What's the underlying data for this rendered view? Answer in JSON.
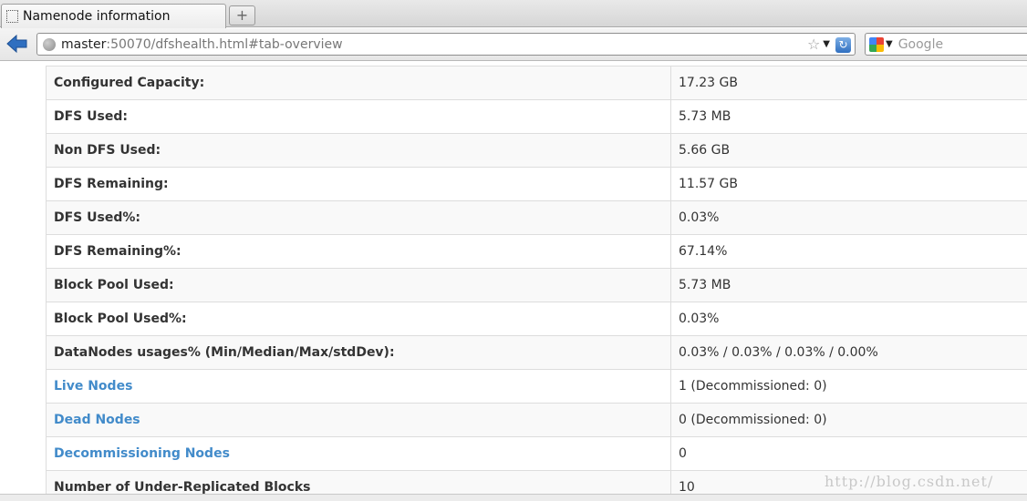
{
  "browser": {
    "tab_title": "Namenode information",
    "new_tab_symbol": "+",
    "url_host": "master",
    "url_rest": ":50070/dfshealth.html#tab-overview",
    "search_placeholder": "Google"
  },
  "overview": {
    "rows": [
      {
        "label": "Configured Capacity:",
        "value": "17.23 GB",
        "link": false
      },
      {
        "label": "DFS Used:",
        "value": "5.73 MB",
        "link": false
      },
      {
        "label": "Non DFS Used:",
        "value": "5.66 GB",
        "link": false
      },
      {
        "label": "DFS Remaining:",
        "value": "11.57 GB",
        "link": false
      },
      {
        "label": "DFS Used%:",
        "value": "0.03%",
        "link": false
      },
      {
        "label": "DFS Remaining%:",
        "value": "67.14%",
        "link": false
      },
      {
        "label": "Block Pool Used:",
        "value": "5.73 MB",
        "link": false
      },
      {
        "label": "Block Pool Used%:",
        "value": "0.03%",
        "link": false
      },
      {
        "label": "DataNodes usages% (Min/Median/Max/stdDev):",
        "value": "0.03% / 0.03% / 0.03% / 0.00%",
        "link": false
      },
      {
        "label": "Live Nodes",
        "value": "1 (Decommissioned: 0)",
        "link": true
      },
      {
        "label": "Dead Nodes",
        "value": "0 (Decommissioned: 0)",
        "link": true
      },
      {
        "label": "Decommissioning Nodes",
        "value": "0",
        "link": true
      },
      {
        "label": "Number of Under-Replicated Blocks",
        "value": "10",
        "link": false
      }
    ]
  },
  "watermark": "http://blog.csdn.net/",
  "colors": {
    "link": "#428bca",
    "row_stripe": "#f9f9f9",
    "border": "#dddddd"
  }
}
